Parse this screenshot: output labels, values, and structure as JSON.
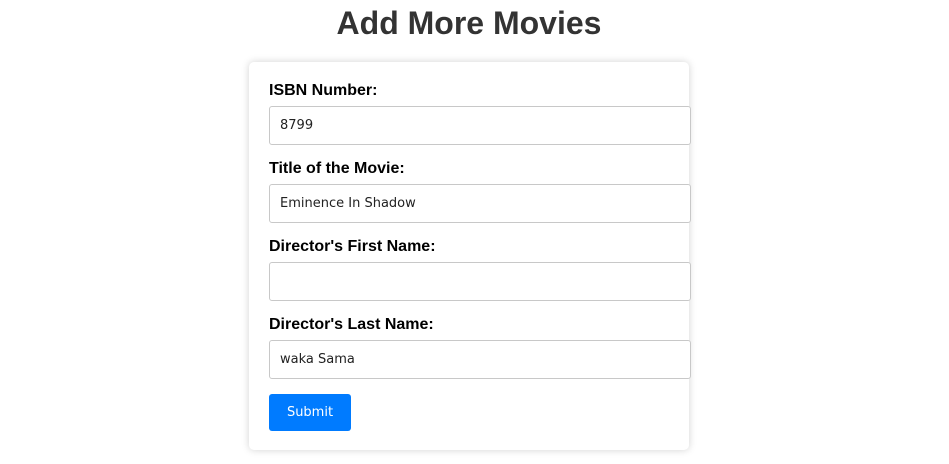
{
  "page": {
    "title": "Add More Movies"
  },
  "form": {
    "fields": [
      {
        "label": "ISBN Number:",
        "value": "8799",
        "placeholder": ""
      },
      {
        "label": "Title of the Movie:",
        "value": "Eminence In Shadow",
        "placeholder": ""
      },
      {
        "label": "Director's First Name:",
        "value": "",
        "placeholder": ""
      },
      {
        "label": "Director's Last Name:",
        "value": "waka Sama",
        "placeholder": ""
      }
    ],
    "submit_label": "Submit"
  },
  "colors": {
    "accent": "#007bff",
    "title_text": "#333333"
  }
}
